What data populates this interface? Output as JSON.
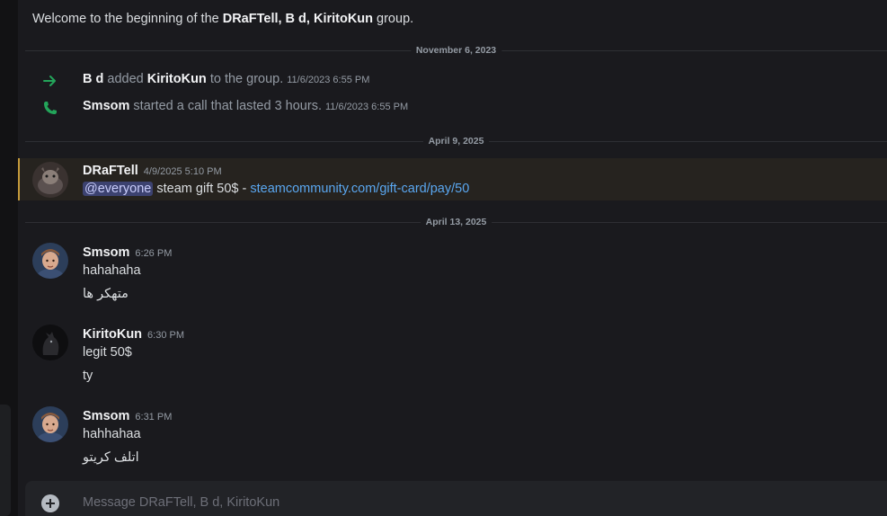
{
  "welcome": {
    "prefix": "Welcome to the beginning of the ",
    "group_name": "DRaFTell, B d, KiritoKun",
    "suffix": " group."
  },
  "dividers": [
    "November 6, 2023",
    "April 9, 2025",
    "April 13, 2025"
  ],
  "system_messages": [
    {
      "icon": "arrow-right-icon",
      "actor": "B d",
      "action": " added ",
      "target": "KiritoKun",
      "tail": " to the group.",
      "timestamp": "11/6/2023 6:55 PM"
    },
    {
      "icon": "phone-icon",
      "actor": "Smsom",
      "action": " started a call that lasted 3 hours.",
      "timestamp": "11/6/2023 6:55 PM"
    }
  ],
  "messages": [
    {
      "author": "DRaFTell",
      "timestamp": "4/9/2025 5:10 PM",
      "mention": "@everyone",
      "text": " steam gift 50$ - ",
      "link": "steamcommunity.com/gift-card/pay/50"
    },
    {
      "author": "Smsom",
      "timestamp": "6:26 PM",
      "lines": [
        "hahahaha",
        "متهكر ها"
      ]
    },
    {
      "author": "KiritoKun",
      "timestamp": "6:30 PM",
      "lines": [
        "legit 50$",
        "ty"
      ]
    },
    {
      "author": "Smsom",
      "timestamp": "6:31 PM",
      "lines": [
        "hahhahaa",
        "اتلف كريتو"
      ]
    }
  ],
  "composer": {
    "placeholder": "Message DRaFTell, B d, KiritoKun"
  },
  "colors": {
    "highlight_border": "#c49a3b",
    "link": "#5aa7f0",
    "system_arrow": "#23a55a",
    "mention_bg": "#3c4270"
  }
}
